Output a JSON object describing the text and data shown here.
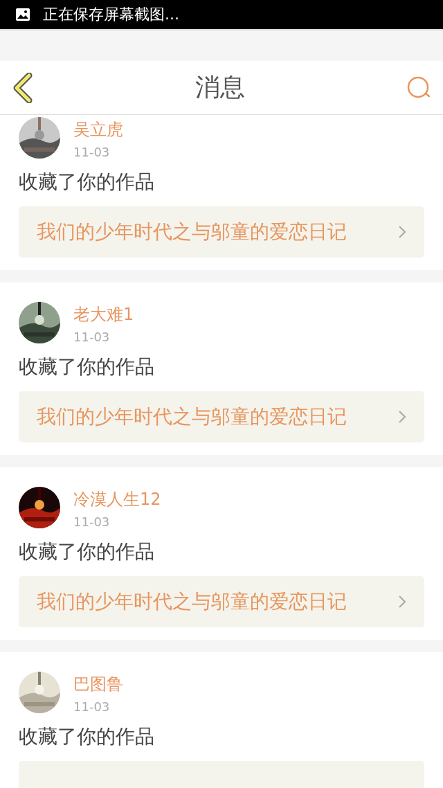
{
  "status_bar": {
    "notification": "正在保存屏幕截图..."
  },
  "header": {
    "title": "消息"
  },
  "messages": [
    {
      "user": "吴立虎",
      "date": "11-03",
      "action": "收藏了你的作品",
      "work": "我们的少年时代之与邬童的爱恋日记"
    },
    {
      "user": "老大难1",
      "date": "11-03",
      "action": "收藏了你的作品",
      "work": "我们的少年时代之与邬童的爱恋日记"
    },
    {
      "user": "冷漠人生12",
      "date": "11-03",
      "action": "收藏了你的作品",
      "work": "我们的少年时代之与邬童的爱恋日记"
    },
    {
      "user": "巴图鲁",
      "date": "11-03",
      "action": "收藏了你的作品"
    }
  ]
}
